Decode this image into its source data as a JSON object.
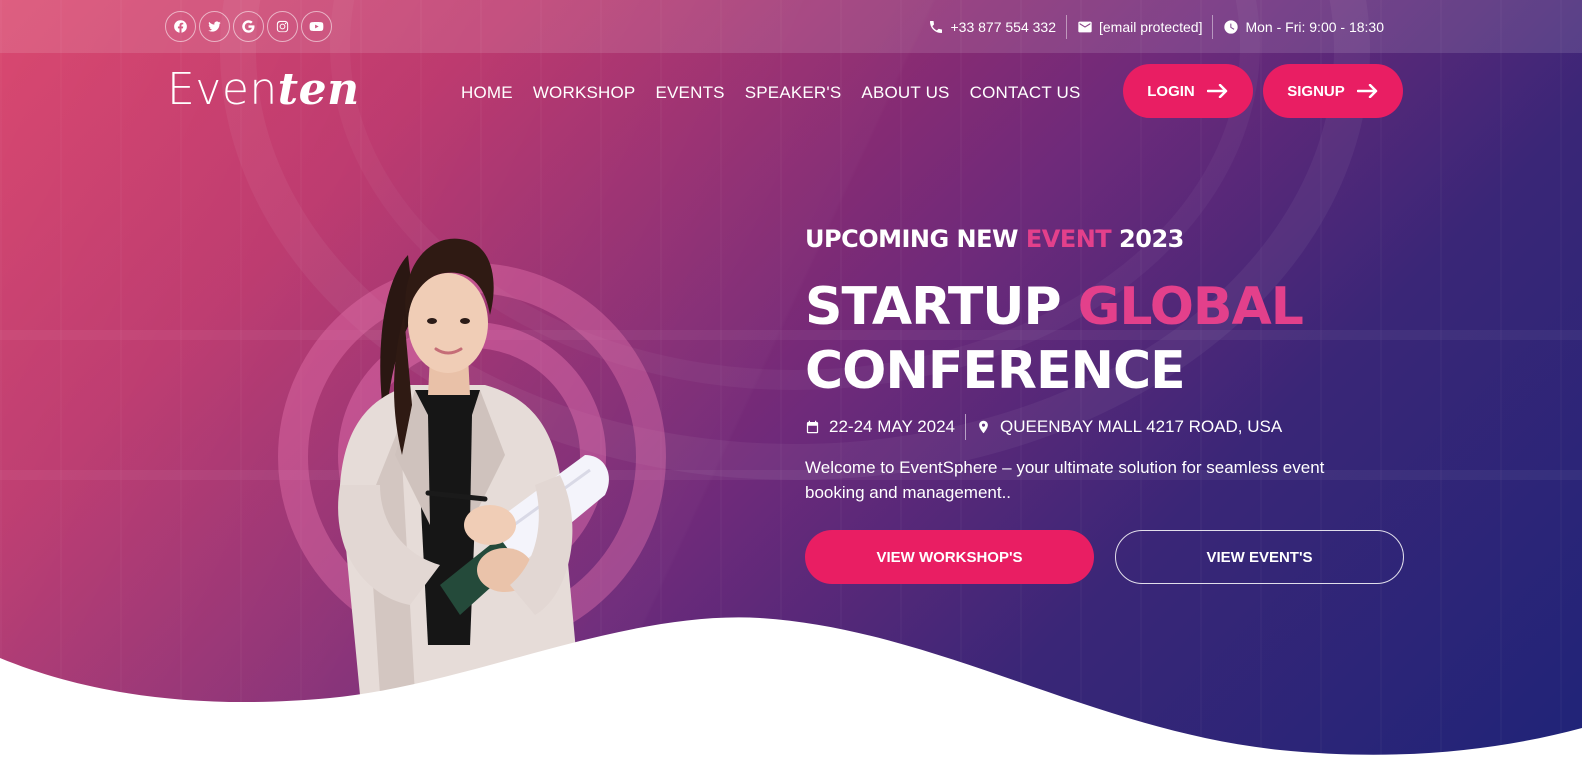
{
  "topbar": {
    "socials": [
      {
        "icon": "facebook-icon"
      },
      {
        "icon": "twitter-icon"
      },
      {
        "icon": "google-icon"
      },
      {
        "icon": "instagram-icon"
      },
      {
        "icon": "youtube-icon"
      }
    ],
    "phone": "+33 877 554 332",
    "email": "[email protected]",
    "hours": "Mon - Fri: 9:00 - 18:30"
  },
  "header": {
    "logo_plain": "Even",
    "logo_script": "ten",
    "nav": [
      "HOME",
      "WORKSHOP",
      "EVENTS",
      "SPEAKER'S",
      "ABOUT US",
      "CONTACT US"
    ],
    "login_label": "LOGIN",
    "signup_label": "SIGNUP"
  },
  "hero": {
    "eyebrow_pre": "UPCOMING NEW ",
    "eyebrow_accent": "EVENT",
    "eyebrow_post": " 2023",
    "headline_pre": "STARTUP ",
    "headline_accent": "GLOBAL",
    "headline_line2": "CONFERENCE",
    "date": "22-24 MAY 2024",
    "location": "QUEENBAY MALL 4217 ROAD, USA",
    "description": "Welcome to EventSphere – your ultimate solution for seamless event booking and management..",
    "workshops_button": "VIEW WORKSHOP'S",
    "events_button": "VIEW EVENT'S"
  },
  "colors": {
    "accent": "#e91e63",
    "accent_text": "#e3408b",
    "gradient_start": "#d6345f",
    "gradient_end": "#1f2478"
  }
}
